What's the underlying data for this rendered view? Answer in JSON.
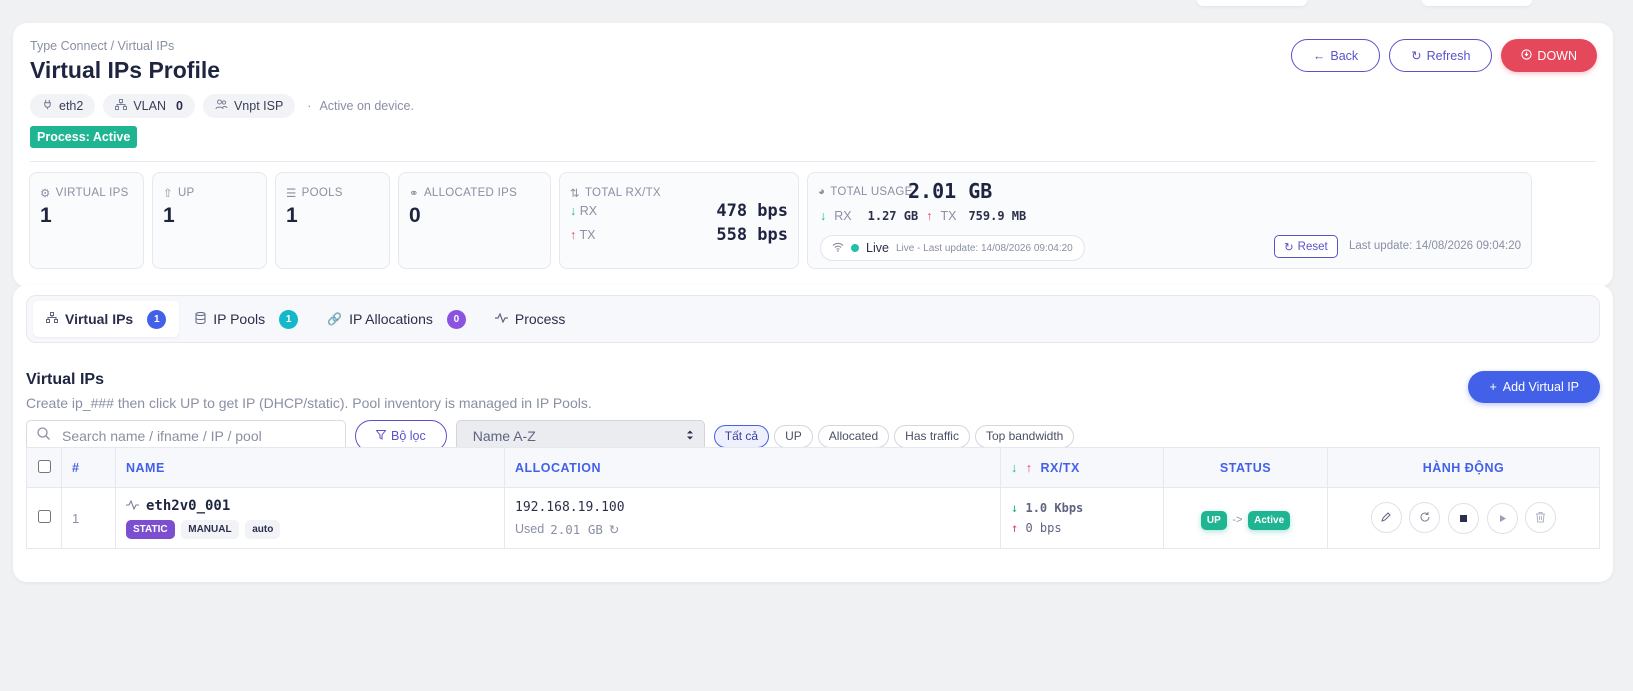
{
  "header": {
    "breadcrumb": "Type Connect / Virtual IPs",
    "title": "Virtual IPs Profile",
    "chips": {
      "iface": "eth2",
      "vlan_label": "VLAN",
      "vlan_value": "0",
      "isp": "Vnpt ISP",
      "note": "Active on device."
    },
    "process_badge": "Process: Active",
    "actions": {
      "back": "Back",
      "refresh": "Refresh",
      "down": "DOWN"
    }
  },
  "stats": {
    "virtual_ips": {
      "label": "VIRTUAL IPS",
      "value": "1"
    },
    "up": {
      "label": "UP",
      "value": "1"
    },
    "pools": {
      "label": "POOLS",
      "value": "1"
    },
    "allocated": {
      "label": "ALLOCATED IPS",
      "value": "0"
    },
    "rxtx": {
      "label": "TOTAL RX/TX",
      "rx_label": "RX",
      "rx_value": "478 bps",
      "tx_label": "TX",
      "tx_value": "558 bps"
    },
    "usage": {
      "label": "TOTAL USAGE",
      "value": "2.01 GB",
      "rx_label": "RX",
      "rx_value": "1.27 GB",
      "tx_label": "TX",
      "tx_value": "759.9 MB",
      "live_label": "Live",
      "live_detail": "Live - Last update: 14/08/2026 09:04:20",
      "reset_label": "Reset",
      "last_update": "Last update: 14/08/2026 09:04:20"
    }
  },
  "tabs": [
    {
      "label": "Virtual IPs",
      "badge": "1",
      "badge_color": "#4361e8"
    },
    {
      "label": "IP Pools",
      "badge": "1",
      "badge_color": "#14b8c9"
    },
    {
      "label": "IP Allocations",
      "badge": "0",
      "badge_color": "#8b54e0"
    },
    {
      "label": "Process"
    }
  ],
  "section": {
    "title": "Virtual IPs",
    "description": "Create ip_### then click UP to get IP (DHCP/static). Pool inventory is managed in IP Pools.",
    "add_button": "Add Virtual IP"
  },
  "filters": {
    "search_placeholder": "Search name / ifname / IP / pool",
    "filter_button": "Bộ lọc",
    "sort_value": "Name A-Z",
    "chips": [
      "Tất cả",
      "UP",
      "Allocated",
      "Has traffic",
      "Top bandwidth"
    ]
  },
  "table": {
    "headers": {
      "index": "#",
      "name": "NAME",
      "allocation": "ALLOCATION",
      "rxtx": "RX/TX",
      "status": "STATUS",
      "actions": "HÀNH ĐỘNG"
    },
    "rows": [
      {
        "index": "1",
        "name": "eth2v0_001",
        "tags": [
          "STATIC",
          "MANUAL",
          "auto"
        ],
        "ip": "192.168.19.100",
        "used_label": "Used",
        "used_value": "2.01 GB",
        "rx": "1.0 Kbps",
        "tx": "0 bps",
        "status": "UP",
        "status_arrow": "->",
        "process": "Active"
      }
    ]
  },
  "colors": {
    "accent": "#4361e8",
    "success": "#1fb592",
    "danger": "#e5485a",
    "purple": "#7b4fcf",
    "outline": "#5a52c9"
  }
}
